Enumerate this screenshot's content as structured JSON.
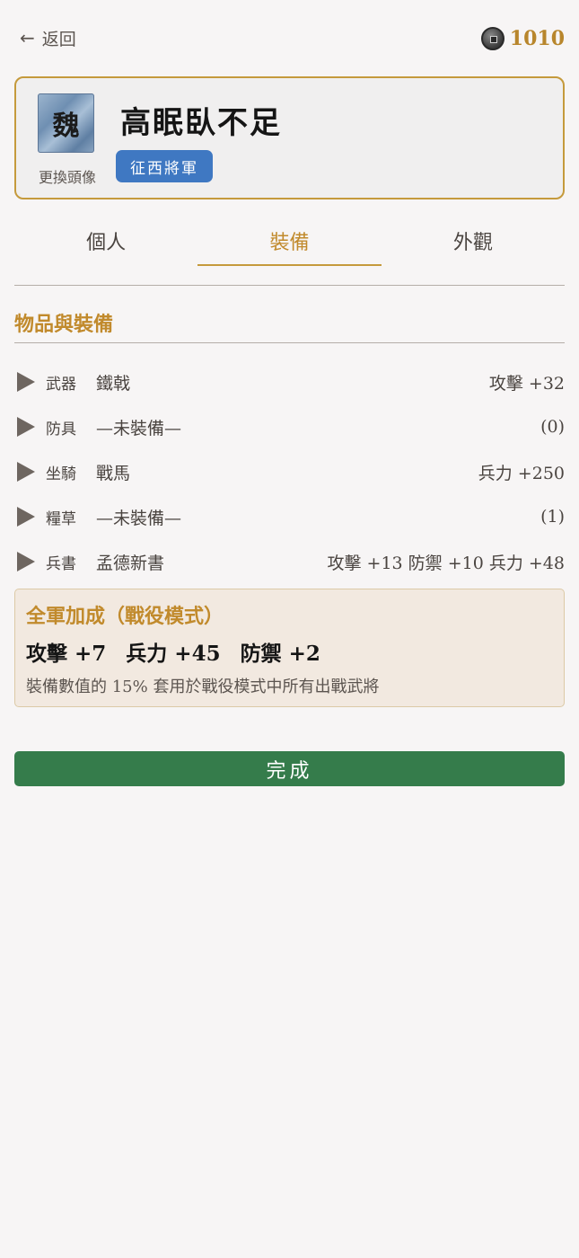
{
  "header": {
    "back_label": "返回",
    "coins": "1010"
  },
  "profile": {
    "avatar_glyph": "魏",
    "change_avatar_label": "更換頭像",
    "name": "高眠臥不足",
    "title_badge": "征西將軍"
  },
  "tabs": [
    {
      "label": "個人",
      "active": false
    },
    {
      "label": "裝備",
      "active": true
    },
    {
      "label": "外觀",
      "active": false
    }
  ],
  "section": {
    "title": "物品與裝備"
  },
  "equipment": [
    {
      "slot": "武器",
      "item": "鐵戟",
      "bonus": "攻擊 +32"
    },
    {
      "slot": "防具",
      "item": "—未裝備—",
      "bonus": "(0)"
    },
    {
      "slot": "坐騎",
      "item": "戰馬",
      "bonus": "兵力 +250"
    },
    {
      "slot": "糧草",
      "item": "—未裝備—",
      "bonus": "(1)"
    },
    {
      "slot": "兵書",
      "item": "孟德新書",
      "bonus": "攻擊 +13  防禦 +10  兵力 +48"
    }
  ],
  "army_bonus": {
    "title": "全軍加成（戰役模式）",
    "stats": [
      "攻擊 +7",
      "兵力 +45",
      "防禦 +2"
    ],
    "note": "裝備數值的 15% 套用於戰役模式中所有出戰武將"
  },
  "done_label": "完成",
  "colors": {
    "accent": "#c18a2c",
    "title_badge": "#3f78c2",
    "done_button": "#357c4b",
    "background": "#f7f5f5"
  }
}
